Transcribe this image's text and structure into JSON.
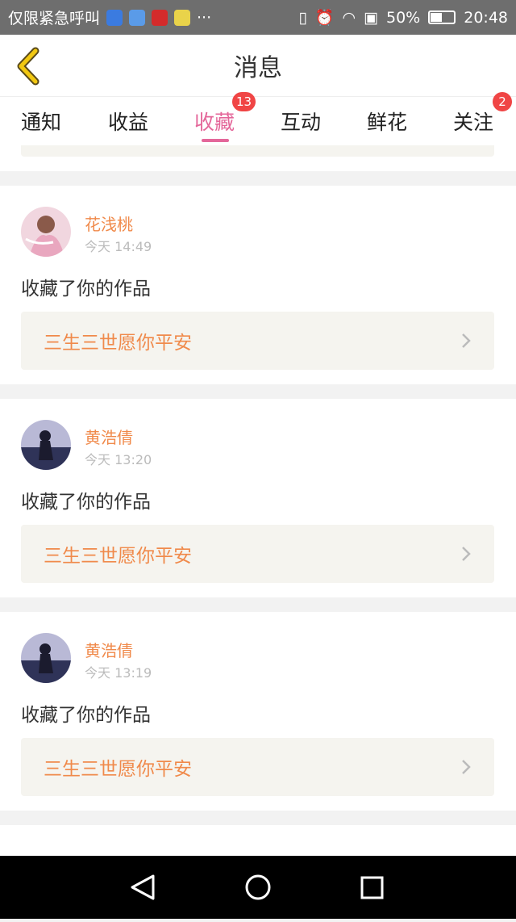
{
  "status_bar": {
    "carrier_text": "仅限紧急呼叫",
    "more": "···",
    "battery_percent": "50%",
    "battery_level": 0.5,
    "time": "20:48"
  },
  "header": {
    "title": "消息"
  },
  "tabs": [
    {
      "label": "通知",
      "badge": ""
    },
    {
      "label": "收益",
      "badge": ""
    },
    {
      "label": "收藏",
      "badge": "13",
      "active": true
    },
    {
      "label": "互动",
      "badge": ""
    },
    {
      "label": "鲜花",
      "badge": ""
    },
    {
      "label": "关注",
      "badge": "2"
    }
  ],
  "feed": [
    {
      "user": "花浅桃",
      "time": "今天 14:49",
      "action": "收藏了你的作品",
      "work": "三生三世愿你平安"
    },
    {
      "user": "黄浩倩",
      "time": "今天 13:20",
      "action": "收藏了你的作品",
      "work": "三生三世愿你平安"
    },
    {
      "user": "黄浩倩",
      "time": "今天 13:19",
      "action": "收藏了你的作品",
      "work": "三生三世愿你平安"
    }
  ],
  "colors": {
    "accent_pink": "#e4679a",
    "accent_orange": "#f08a4b",
    "badge_red": "#f04545",
    "back_arrow": "#e8b800"
  }
}
